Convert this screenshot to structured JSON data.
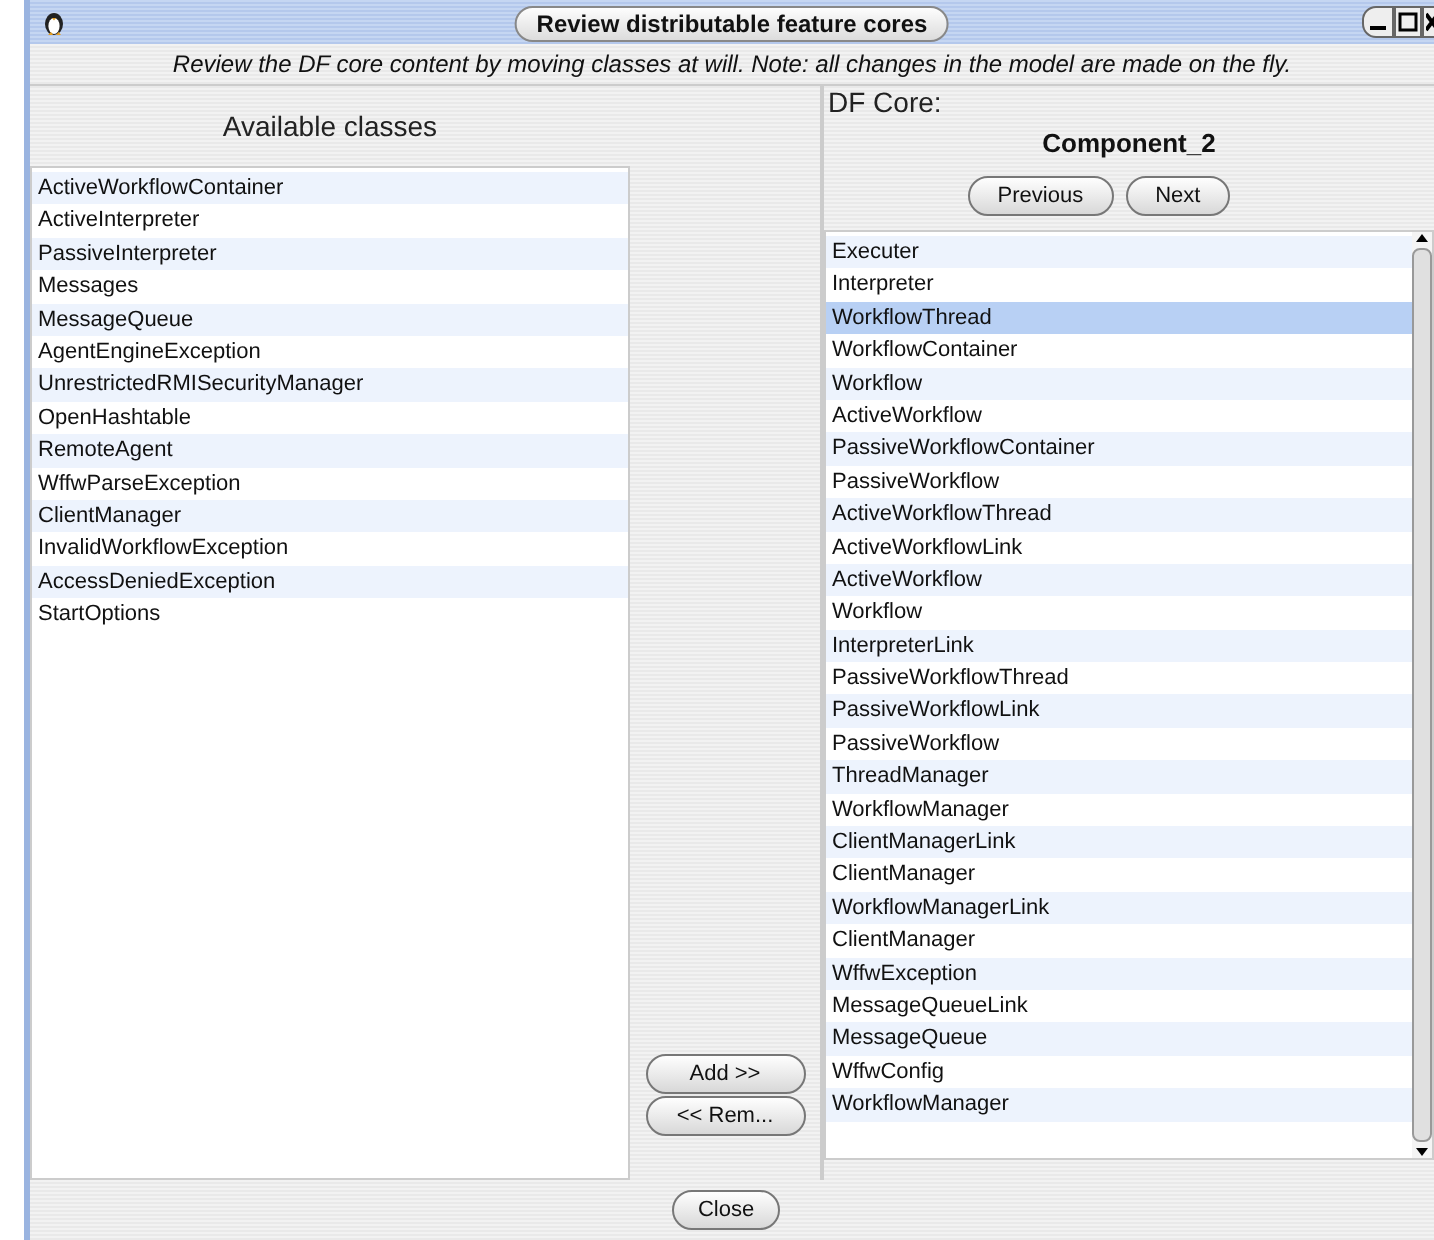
{
  "window": {
    "title": "Review distributable feature cores"
  },
  "instruction": "Review the DF core content by moving classes at will. Note: all changes in the model are made on the fly.",
  "available": {
    "heading": "Available classes",
    "items": [
      {
        "label": "ActiveWorkflowContainer",
        "selected": false
      },
      {
        "label": "ActiveInterpreter",
        "selected": false
      },
      {
        "label": "PassiveInterpreter",
        "selected": false
      },
      {
        "label": "Messages",
        "selected": false
      },
      {
        "label": "MessageQueue",
        "selected": false
      },
      {
        "label": "AgentEngineException",
        "selected": false
      },
      {
        "label": "UnrestrictedRMISecurityManager",
        "selected": false
      },
      {
        "label": "OpenHashtable",
        "selected": false
      },
      {
        "label": "RemoteAgent",
        "selected": false
      },
      {
        "label": "WffwParseException",
        "selected": false
      },
      {
        "label": "ClientManager",
        "selected": false
      },
      {
        "label": "InvalidWorkflowException",
        "selected": false
      },
      {
        "label": "AccessDeniedException",
        "selected": false
      },
      {
        "label": "StartOptions",
        "selected": false
      }
    ]
  },
  "move_buttons": [
    "Add  >>",
    "<< Rem..."
  ],
  "core": {
    "label": "DF Core:",
    "name": "Component_2",
    "nav_buttons": [
      "Previous",
      "Next"
    ],
    "items": [
      {
        "label": "Executer",
        "selected": false
      },
      {
        "label": "Interpreter",
        "selected": false
      },
      {
        "label": "WorkflowThread",
        "selected": true
      },
      {
        "label": "WorkflowContainer",
        "selected": false
      },
      {
        "label": "Workflow",
        "selected": false
      },
      {
        "label": "ActiveWorkflow",
        "selected": false
      },
      {
        "label": "PassiveWorkflowContainer",
        "selected": false
      },
      {
        "label": "PassiveWorkflow",
        "selected": false
      },
      {
        "label": "ActiveWorkflowThread",
        "selected": false
      },
      {
        "label": "ActiveWorkflowLink",
        "selected": false
      },
      {
        "label": "ActiveWorkflow",
        "selected": false
      },
      {
        "label": "Workflow",
        "selected": false
      },
      {
        "label": "InterpreterLink",
        "selected": false
      },
      {
        "label": "PassiveWorkflowThread",
        "selected": false
      },
      {
        "label": "PassiveWorkflowLink",
        "selected": false
      },
      {
        "label": "PassiveWorkflow",
        "selected": false
      },
      {
        "label": "ThreadManager",
        "selected": false
      },
      {
        "label": "WorkflowManager",
        "selected": false
      },
      {
        "label": "ClientManagerLink",
        "selected": false
      },
      {
        "label": "ClientManager",
        "selected": false
      },
      {
        "label": "WorkflowManagerLink",
        "selected": false
      },
      {
        "label": "ClientManager",
        "selected": false
      },
      {
        "label": "WffwException",
        "selected": false
      },
      {
        "label": "MessageQueueLink",
        "selected": false
      },
      {
        "label": "MessageQueue",
        "selected": false
      },
      {
        "label": "WffwConfig",
        "selected": false
      },
      {
        "label": "WorkflowManager",
        "selected": false
      }
    ]
  },
  "close_button": "Close"
}
